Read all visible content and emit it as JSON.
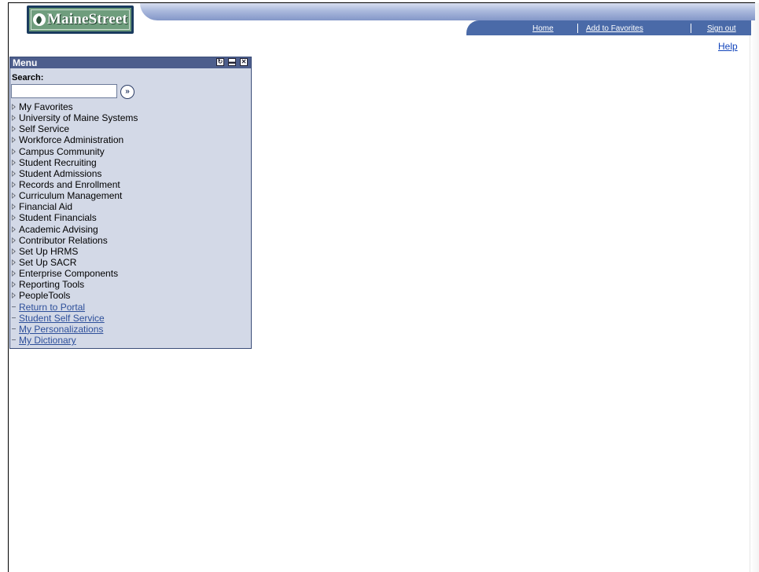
{
  "logo": {
    "text": "MaineStreet"
  },
  "nav": {
    "home": "Home",
    "add_favorites": "Add to Favorites",
    "sign_out": "Sign out",
    "help": "Help"
  },
  "menu": {
    "title": "Menu",
    "search_label": "Search:",
    "search_value": "",
    "folders": [
      "My Favorites",
      "University of Maine Systems",
      "Self Service",
      "Workforce Administration",
      "Campus Community",
      "Student Recruiting",
      "Student Admissions",
      "Records and Enrollment",
      "Curriculum Management",
      "Financial Aid",
      "Student Financials",
      "Academic Advising",
      "Contributor Relations",
      "Set Up HRMS",
      "Set Up SACR",
      "Enterprise Components",
      "Reporting Tools",
      "PeopleTools"
    ],
    "links": [
      "Return to Portal",
      "Student Self Service",
      "My Personalizations",
      "My Dictionary"
    ]
  }
}
